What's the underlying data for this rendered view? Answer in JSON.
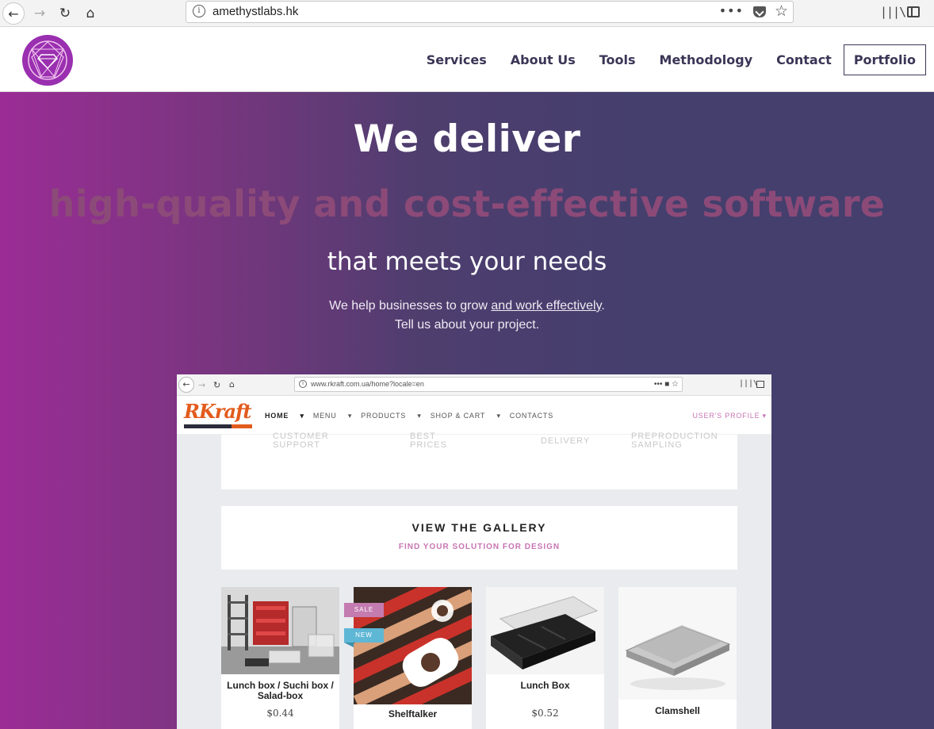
{
  "browser": {
    "url": "amethystlabs.hk"
  },
  "nav": {
    "items": [
      "Services",
      "About Us",
      "Tools",
      "Methodology",
      "Contact"
    ],
    "portfolio_label": "Portfolio"
  },
  "hero": {
    "title": "We deliver",
    "highlight": "high-quality and cost-effective software",
    "subtitle": "that meets your needs",
    "text_prefix": "We help businesses to grow ",
    "text_link": "and work effectively",
    "text_suffix": ".",
    "text_line2": "Tell us about your project."
  },
  "portfolio_screenshot": {
    "url": "www.rkraft.com.ua/home?locale=en",
    "logo": "RKraft",
    "nav": [
      "HOME",
      "MENU",
      "PRODUCTS",
      "SHOP & CART",
      "CONTACTS"
    ],
    "profile": "USER'S PROFILE",
    "features": [
      "CUSTOMER SUPPORT",
      "BEST PRICES",
      "DELIVERY",
      "PREPRODUCTION SAMPLING"
    ],
    "gallery_title": "VIEW THE GALLERY",
    "gallery_subtitle": "FIND YOUR SOLUTION FOR DESIGN",
    "products": [
      {
        "name": "Lunch box / Suchi box / Salad-box",
        "price": "$0.44"
      },
      {
        "name": "Shelftalker",
        "price": "",
        "badges": [
          "SALE",
          "NEW"
        ]
      },
      {
        "name": "Lunch Box",
        "price": "$0.52"
      },
      {
        "name": "Clamshell",
        "price": ""
      }
    ]
  },
  "colors": {
    "brand_purple": "#9a2fb0",
    "nav_text": "#3b3556",
    "hero_left": "#9b2c96",
    "hero_right": "#443f6d",
    "highlight": "#8c4a78",
    "accent_pink": "#c774b3"
  }
}
